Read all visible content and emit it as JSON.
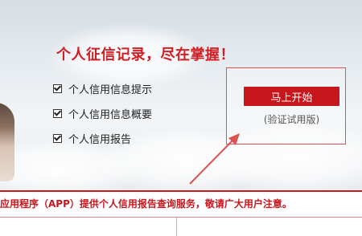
{
  "banner": {
    "headline": "个人征信记录，尽在掌握！",
    "features": [
      {
        "label": "个人信用信息提示",
        "icon": "checkbox-icon"
      },
      {
        "label": "个人信用信息概要",
        "icon": "checkbox-icon"
      },
      {
        "label": "个人信用报告",
        "icon": "checkbox-icon"
      }
    ],
    "start_button_label": "马上开始",
    "trial_note": "(验证试用版)"
  },
  "notice": {
    "text": "应用程序（APP）提供个人信用报告查询服务，敬请广大用户注意。"
  },
  "colors": {
    "accent": "#c8161d",
    "headline": "#cf1f25",
    "box_border": "#d9534f"
  }
}
